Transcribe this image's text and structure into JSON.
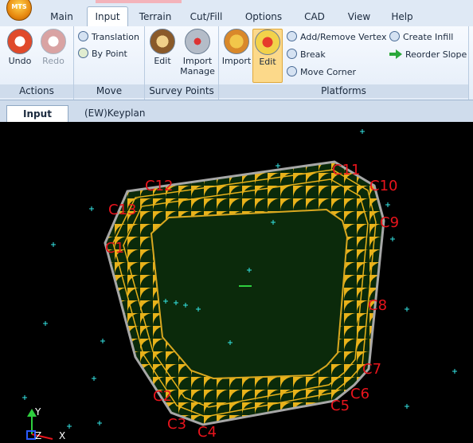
{
  "app": {
    "logo_text": "MTS"
  },
  "tabs": [
    "Main",
    "Input",
    "Terrain",
    "Cut/Fill",
    "Options",
    "CAD",
    "View",
    "Help"
  ],
  "ribbon": {
    "actions": {
      "label": "Actions",
      "undo": "Undo",
      "redo": "Redo"
    },
    "move": {
      "label": "Move",
      "translation": "Translation",
      "by_point": "By Point"
    },
    "survey_points": {
      "label": "Survey Points",
      "edit": "Edit",
      "import_manage_1": "Import",
      "import_manage_2": "Manage"
    },
    "platforms": {
      "label": "Platforms",
      "import": "Import",
      "edit": "Edit",
      "add_remove_vertex": "Add/Remove Vertex",
      "break": "Break",
      "move_corner": "Move Corner",
      "create_infill": "Create Infill",
      "reorder_slope": "Reorder Slope"
    }
  },
  "doc_tabs": [
    "Input",
    "(EW)Keyplan"
  ],
  "corners": [
    "C1",
    "C2",
    "C3",
    "C4",
    "C5",
    "C6",
    "C7",
    "C8",
    "C9",
    "C10",
    "C11",
    "C12",
    "C13"
  ],
  "axis": {
    "y": "Y",
    "z": "Z",
    "x": "X"
  },
  "colors": {
    "platform_fill": "#0b2a0b",
    "batter": "#e8b21a",
    "outline": "#a7a7a7",
    "survey_point": "#35e6e6",
    "corner_label": "#e8141c"
  }
}
